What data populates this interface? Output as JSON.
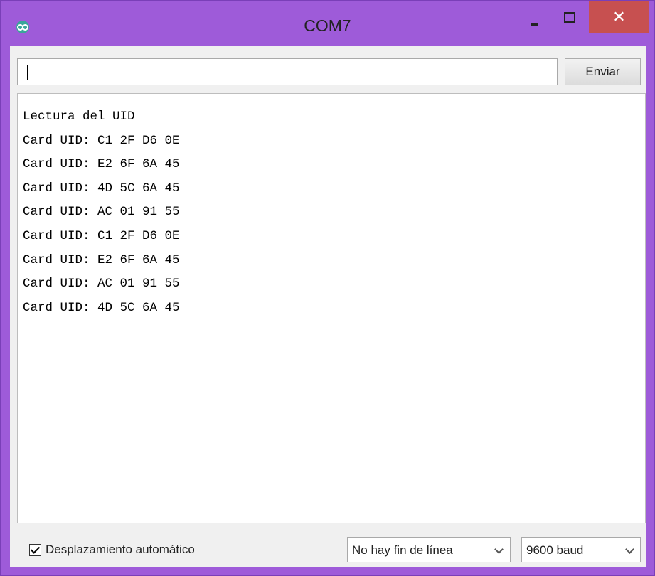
{
  "window": {
    "title": "COM7",
    "close_glyph": "✕"
  },
  "toolbar": {
    "send_input_value": "",
    "send_label": "Enviar"
  },
  "output": {
    "lines": [
      "Lectura del UID",
      "Card UID: C1 2F D6 0E",
      "Card UID: E2 6F 6A 45",
      "Card UID: 4D 5C 6A 45",
      "Card UID: AC 01 91 55",
      "Card UID: C1 2F D6 0E",
      "Card UID: E2 6F 6A 45",
      "Card UID: AC 01 91 55",
      "Card UID: 4D 5C 6A 45"
    ]
  },
  "footer": {
    "autoscroll_label": "Desplazamiento automático",
    "autoscroll_checked": true,
    "line_ending": "No hay fin de línea",
    "baud_rate": "9600 baud"
  },
  "colors": {
    "titlebar": "#9e5bd9",
    "close_button": "#c75050",
    "app_icon": "#3aa59b"
  },
  "icons": [
    "arduino-logo-icon",
    "minimize-icon",
    "maximize-icon",
    "close-icon",
    "checkmark-icon",
    "chevron-down-icon"
  ]
}
